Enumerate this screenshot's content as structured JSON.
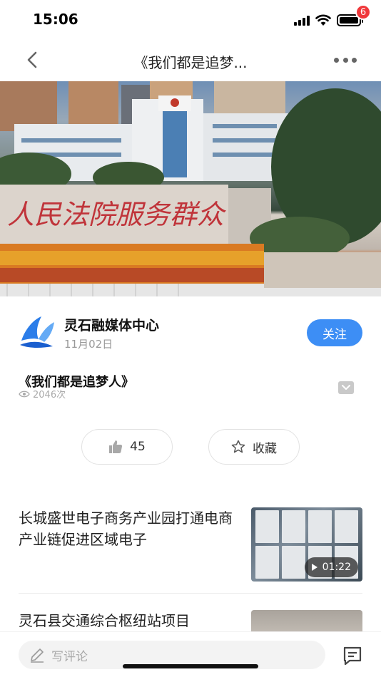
{
  "status_bar": {
    "time": "15:06"
  },
  "nav": {
    "title": "《我们都是追梦..."
  },
  "video": {
    "sign_text": "人民法院服务群众",
    "colors": {
      "sky": "#6f8fb5",
      "flowers": "#e1891f"
    }
  },
  "author": {
    "name": "灵石融媒体中心",
    "date": "11月02日",
    "follow_label": "关注",
    "accent": "#3d8ef5"
  },
  "article": {
    "title": "《我们都是追梦人》",
    "views": "2046次"
  },
  "actions": {
    "like_count": "45",
    "favorite_label": "收藏"
  },
  "related": [
    {
      "title": "长城盛世电子商务产业园打通电商产业链促进区域电子",
      "duration": "01:22"
    },
    {
      "title": "灵石县交通综合枢纽站项目"
    }
  ],
  "bottom_bar": {
    "comment_placeholder": "写评论",
    "comment_count": "6",
    "badge_color": "#f0383b"
  }
}
